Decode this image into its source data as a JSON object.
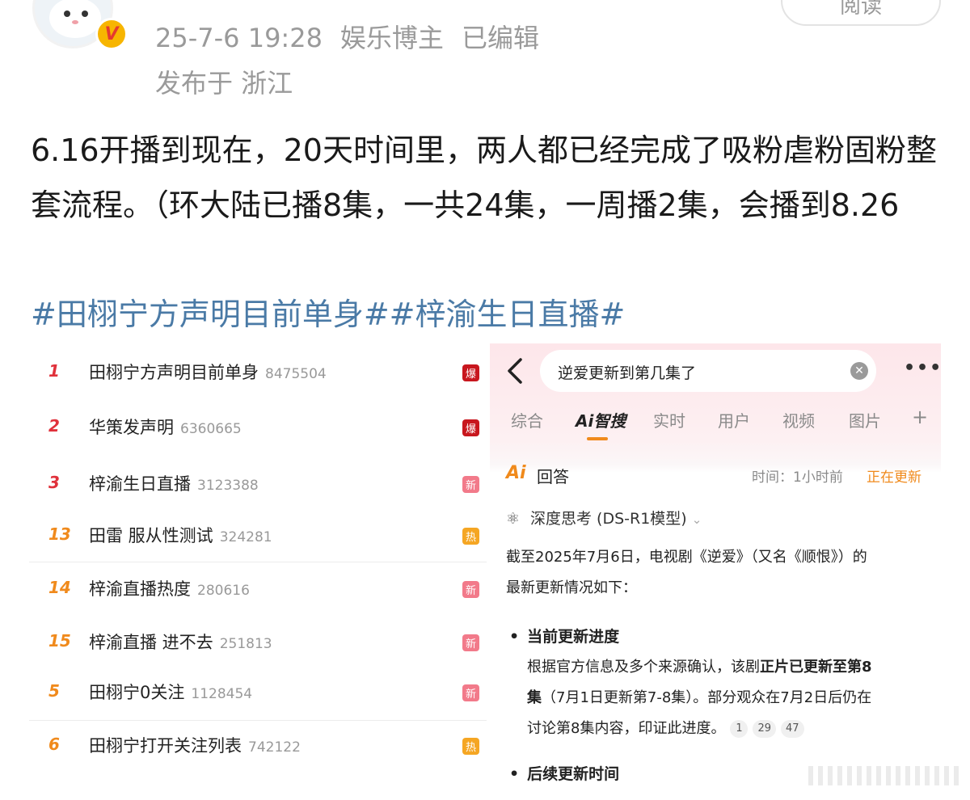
{
  "post": {
    "timestamp": "25-7-6 19:28",
    "author_tag": "娱乐博主",
    "edited": "已编辑",
    "location": "发布于 浙江",
    "read_button": "阅读",
    "body": "6.16开播到现在，20天时间里，两人都已经完成了吸粉虐粉固粉整套流程。（环大陆已播8集，一共24集，一周播2集，会播到8.26",
    "tags": "#田栩宁方声明目前单身##梓渝生日直播#"
  },
  "hot_list": {
    "items": [
      {
        "rank": "1",
        "title": "田栩宁方声明目前单身",
        "count": "8475504",
        "badge": "爆",
        "badge_color": "#c8171e",
        "rank_color": "#e0313b"
      },
      {
        "rank": "2",
        "title": "华策发声明",
        "count": "6360665",
        "badge": "爆",
        "badge_color": "#c8171e",
        "rank_color": "#e0313b"
      },
      {
        "rank": "3",
        "title": "梓渝生日直播",
        "count": "3123388",
        "badge": "新",
        "badge_color": "#f27a8a",
        "rank_color": "#e0313b"
      },
      {
        "rank": "13",
        "title": "田雷 服从性测试",
        "count": "324281",
        "badge": "热",
        "badge_color": "#f5a623",
        "rank_color": "#f08a1c"
      },
      {
        "rank": "14",
        "title": "梓渝直播热度",
        "count": "280616",
        "badge": "新",
        "badge_color": "#f27a8a",
        "rank_color": "#f08a1c"
      },
      {
        "rank": "15",
        "title": "梓渝直播 进不去",
        "count": "251813",
        "badge": "新",
        "badge_color": "#f27a8a",
        "rank_color": "#f08a1c"
      },
      {
        "rank": "5",
        "title": "田栩宁0关注",
        "count": "1128454",
        "badge": "新",
        "badge_color": "#f27a8a",
        "rank_color": "#f08a1c"
      },
      {
        "rank": "6",
        "title": "田栩宁打开关注列表",
        "count": "742122",
        "badge": "热",
        "badge_color": "#f5a623",
        "rank_color": "#f08a1c"
      }
    ]
  },
  "ai_search": {
    "query": "逆爱更新到第几集了",
    "tabs": [
      "综合",
      "Ai智搜",
      "实时",
      "用户",
      "视频",
      "图片",
      "+"
    ],
    "answer_logo": "Ai",
    "answer_label": "回答",
    "time": "时间：1小时前",
    "status": "正在更新",
    "think": "深度思考 (DS-R1模型)",
    "intro_line1": "截至2025年7月6日，电视剧《逆爱》（又名《顺恨》）的",
    "intro_line2": "最新更新情况如下：",
    "section1_title": "当前更新进度",
    "section1_line1_a": "根据官方信息及多个来源确认，该剧",
    "section1_line1_b": "正片已更新至第8",
    "section1_line2_a": "集",
    "section1_line2_b": "（7月1日更新第7-8集）。部分观众在7月2日后仍在",
    "section1_line3": "讨论第8集内容，印证此进度。",
    "citations": [
      "1",
      "29",
      "47"
    ],
    "section2_title": "后续更新时间"
  }
}
